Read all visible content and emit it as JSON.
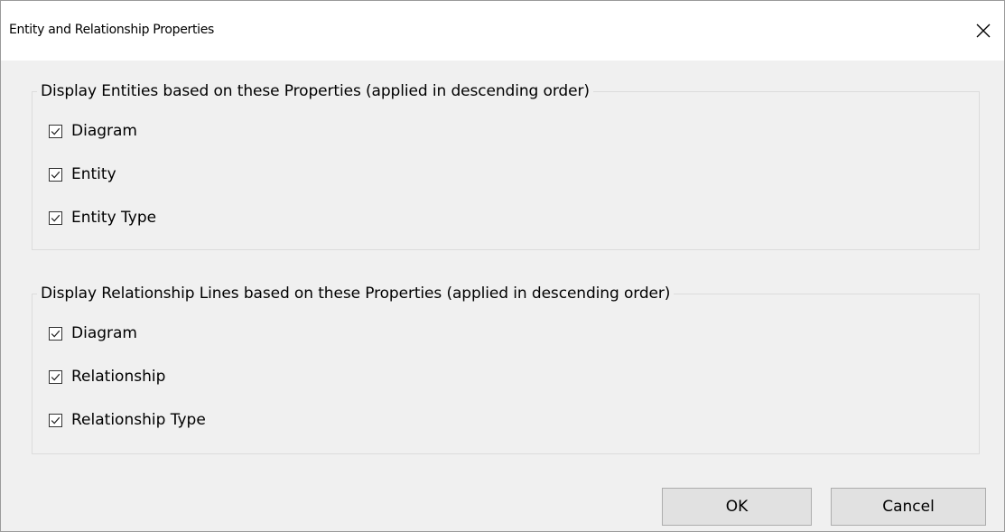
{
  "window": {
    "title": "Entity and Relationship Properties"
  },
  "entities_group": {
    "legend": "Display Entities based on these Properties (applied in descending order)",
    "items": [
      {
        "label": "Diagram",
        "checked": true
      },
      {
        "label": "Entity",
        "checked": true
      },
      {
        "label": "Entity Type",
        "checked": true
      }
    ]
  },
  "relationships_group": {
    "legend": "Display Relationship Lines based on these Properties (applied in descending order)",
    "items": [
      {
        "label": "Diagram",
        "checked": true
      },
      {
        "label": "Relationship",
        "checked": true
      },
      {
        "label": "Relationship Type",
        "checked": true
      }
    ]
  },
  "buttons": {
    "ok": "OK",
    "cancel": "Cancel"
  },
  "icons": {
    "close": "close-icon",
    "check": "checkmark-icon"
  }
}
